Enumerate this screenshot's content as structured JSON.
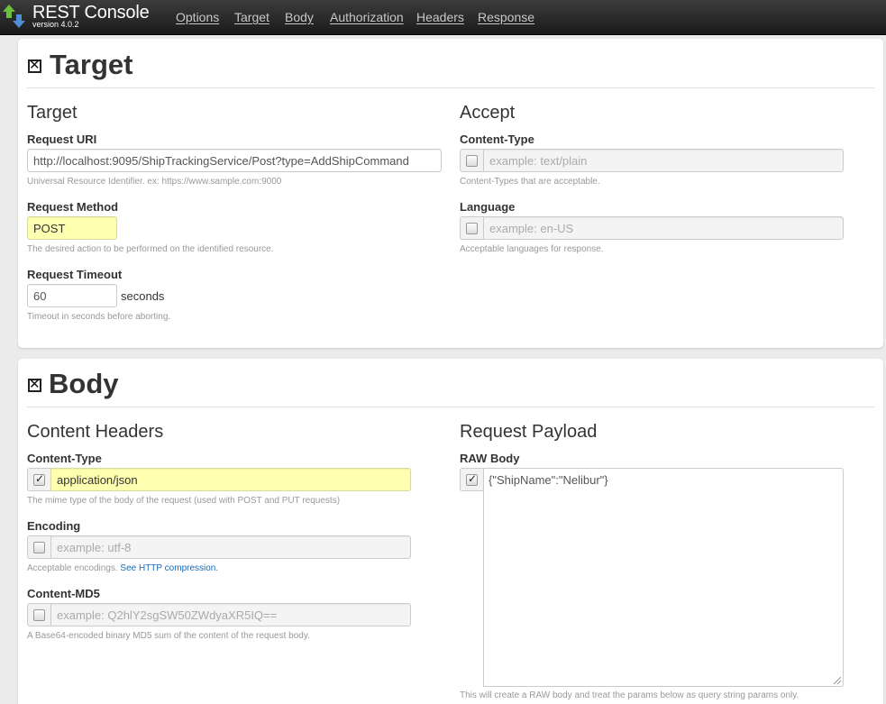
{
  "app": {
    "title": "REST Console",
    "version": "version 4.0.2",
    "nav": [
      "Options",
      "Target",
      "Body",
      "Authorization",
      "Headers",
      "Response"
    ]
  },
  "target_section": {
    "title": "Target",
    "left": {
      "heading": "Target",
      "request_uri": {
        "label": "Request URI",
        "value": "http://localhost:9095/ShipTrackingService/Post?type=AddShipCommand",
        "help": "Universal Resource Identifier. ex: https://www.sample.com:9000"
      },
      "request_method": {
        "label": "Request Method",
        "value": "POST",
        "help": "The desired action to be performed on the identified resource."
      },
      "request_timeout": {
        "label": "Request Timeout",
        "value": "60",
        "unit": "seconds",
        "help": "Timeout in seconds before aborting."
      }
    },
    "right": {
      "heading": "Accept",
      "content_type": {
        "label": "Content-Type",
        "placeholder": "example: text/plain",
        "checked": false,
        "help": "Content-Types that are acceptable."
      },
      "language": {
        "label": "Language",
        "placeholder": "example: en-US",
        "checked": false,
        "help": "Acceptable languages for response."
      }
    }
  },
  "body_section": {
    "title": "Body",
    "left": {
      "heading": "Content Headers",
      "content_type": {
        "label": "Content-Type",
        "value": "application/json",
        "checked": true,
        "help": "The mime type of the body of the request (used with POST and PUT requests)"
      },
      "encoding": {
        "label": "Encoding",
        "placeholder": "example: utf-8",
        "checked": false,
        "help": "Acceptable encodings.",
        "help_link": "See HTTP compression."
      },
      "content_md5": {
        "label": "Content-MD5",
        "placeholder": "example: Q2hlY2sgSW50ZWdyaXR5IQ==",
        "checked": false,
        "help": "A Base64-encoded binary MD5 sum of the content of the request body."
      }
    },
    "right": {
      "heading": "Request Payload",
      "raw_body": {
        "label": "RAW Body",
        "value": "{\"ShipName\":\"Nelibur\"}",
        "checked": true,
        "help": "This will create a RAW body and treat the params below as query string params only."
      }
    }
  },
  "colors": {
    "navbar": "#2a2a2a",
    "highlight_field": "#ffffb0",
    "help_link": "#1a6ab0"
  }
}
